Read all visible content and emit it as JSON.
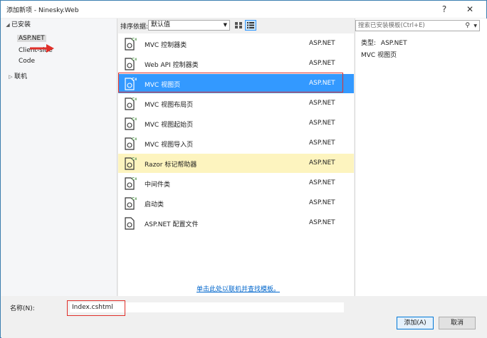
{
  "window": {
    "title": "添加新项 - Ninesky.Web",
    "help": "?",
    "close": "✕"
  },
  "tree": {
    "installed": "已安装",
    "items": [
      "ASP.NET",
      "Client-side",
      "Code"
    ],
    "online": "联机"
  },
  "toolbar": {
    "sort_label": "排序依据:",
    "sort_value": "默认值"
  },
  "templates": [
    {
      "name": "MVC 控制器类",
      "category": "ASP.NET"
    },
    {
      "name": "Web API 控制器类",
      "category": "ASP.NET"
    },
    {
      "name": "MVC 视图页",
      "category": "ASP.NET"
    },
    {
      "name": "MVC 视图布局页",
      "category": "ASP.NET"
    },
    {
      "name": "MVC 视图起始页",
      "category": "ASP.NET"
    },
    {
      "name": "MVC 视图导入页",
      "category": "ASP.NET"
    },
    {
      "name": "Razor 标记帮助器",
      "category": "ASP.NET"
    },
    {
      "name": "中间件类",
      "category": "ASP.NET"
    },
    {
      "name": "启动类",
      "category": "ASP.NET"
    },
    {
      "name": "ASP.NET 配置文件",
      "category": "ASP.NET"
    }
  ],
  "online_link": "单击此处以联机并查找模板。",
  "search": {
    "placeholder": "搜索已安装模板(Ctrl+E)"
  },
  "details": {
    "type_label": "类型:",
    "type_value": "ASP.NET",
    "description": "MVC 视图页"
  },
  "name_field": {
    "label": "名称(N):",
    "value": "Index.cshtml"
  },
  "buttons": {
    "add": "添加(A)",
    "cancel": "取消"
  },
  "colors": {
    "selection": "#3399ff",
    "hover": "#fdf4bf",
    "annotation": "#e0302a"
  }
}
